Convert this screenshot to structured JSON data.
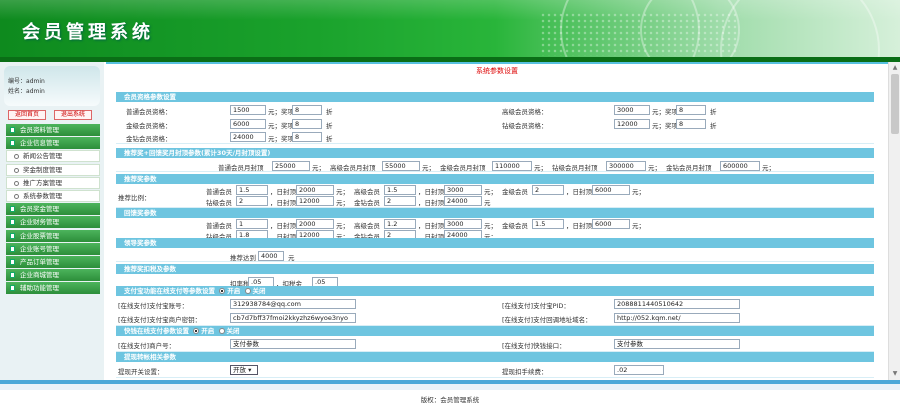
{
  "app": {
    "title": "会员管理系统",
    "footer": "版权：会员管理系统"
  },
  "user": {
    "id_label": "编号：",
    "id_value": "admin",
    "name_label": "姓名：",
    "name_value": "admin"
  },
  "sidebar": {
    "buttons": [
      "返回首页",
      "退出系统"
    ],
    "items": [
      {
        "type": "group",
        "label": "会员资料管理"
      },
      {
        "type": "group",
        "label": "企业信息管理"
      },
      {
        "type": "sub",
        "label": "新闻公告管理"
      },
      {
        "type": "sub",
        "label": "奖金制度管理"
      },
      {
        "type": "sub",
        "label": "推广方案管理"
      },
      {
        "type": "sub",
        "label": "系统参数管理"
      },
      {
        "type": "group",
        "label": "会员奖金管理"
      },
      {
        "type": "group",
        "label": "企业财务管理"
      },
      {
        "type": "group",
        "label": "企业股票管理"
      },
      {
        "type": "group",
        "label": "企业账号管理"
      },
      {
        "type": "group",
        "label": "产品订单管理"
      },
      {
        "type": "group",
        "label": "企业商城管理"
      },
      {
        "type": "group",
        "label": "辅助功能管理"
      }
    ]
  },
  "page": {
    "title": "系统参数设置",
    "s1": "会员资格参数设置",
    "s1_rows": {
      "a_label": "普通会员资格：",
      "a_val": "1500",
      "a_unit": "元；奖项",
      "a_val2": "8",
      "a_unit2": "折",
      "b_label": "高级会员资格：",
      "b_val": "3000",
      "b_unit": "元；奖项",
      "b_val2": "8",
      "b_unit2": "折",
      "c_label": "金级会员资格：",
      "c_val": "6000",
      "c_unit": "元；奖项",
      "c_val2": "8",
      "c_unit2": "折",
      "d_label": "钻级会员资格：",
      "d_val": "12000",
      "d_unit": "元；奖项",
      "d_val2": "8",
      "d_unit2": "折",
      "e_label": "金钻会员资格：",
      "e_val": "24000",
      "e_unit": "元；奖项",
      "e_val2": "8",
      "e_unit2": "折"
    },
    "s2": "推荐奖+回馈奖月封顶参数(累计30天/月封顶设置)",
    "s2_row": {
      "l1": "普通会员月封顶",
      "v1": "25000",
      "u1": "元；",
      "l2": "高级会员月封顶",
      "v2": "55000",
      "u2": "元；",
      "l3": "金级会员月封顶",
      "v3": "110000",
      "u3": "元；",
      "l4": "钻级会员月封顶",
      "v4": "300000",
      "u4": "元；",
      "l5": "金钻会员月封顶",
      "v5": "600000",
      "u5": "元；"
    },
    "s3": "推荐奖参数",
    "s3_row": {
      "side_label": "推荐比例：",
      "r1": [
        {
          "l": "普通会员",
          "v": "1.5",
          "m": "，日封顶",
          "c": "2000",
          "u": "元；"
        },
        {
          "l": "高级会员",
          "v": "1.5",
          "m": "，日封顶",
          "c": "3000",
          "u": "元；"
        },
        {
          "l": "金级会员",
          "v": "2",
          "m": "，日封顶",
          "c": "6000",
          "u": "元；"
        }
      ],
      "r2": [
        {
          "l": "钻级会员",
          "v": "2",
          "m": "，日封顶",
          "c": "12000",
          "u": "元；"
        },
        {
          "l": "金钻会员",
          "v": "2",
          "m": "，日封顶",
          "c": "24000",
          "u": "元"
        }
      ]
    },
    "s4": "回馈奖参数",
    "s4_row": {
      "r1": [
        {
          "l": "普通会员",
          "v": "1",
          "m": "，日封顶",
          "c": "2000",
          "u": "元；"
        },
        {
          "l": "高级会员",
          "v": "1.2",
          "m": "，日封顶",
          "c": "3000",
          "u": "元；"
        },
        {
          "l": "金级会员",
          "v": "1.5",
          "m": "，日封顶",
          "c": "6000",
          "u": "元；"
        }
      ],
      "r2": [
        {
          "l": "钻级会员",
          "v": "1.8",
          "m": "，日封顶",
          "c": "12000",
          "u": "元；"
        },
        {
          "l": "金钻会员",
          "v": "2",
          "m": "，日封顶",
          "c": "24000",
          "u": "元；"
        }
      ]
    },
    "s5": "领导奖参数",
    "s5_row": {
      "l": "推荐达到",
      "v": "4000",
      "u": "元"
    },
    "s6": "推荐奖扣税及参数",
    "s6_row": {
      "l1": "扣率税",
      "v1": ".05",
      "u1": "，扣税金",
      "v2": ".05"
    },
    "s7": "支付宝功能在线支付等参数设置",
    "s7_opts": {
      "on": "开启",
      "off": "关闭"
    },
    "s7_rows": {
      "l1": "[在线支付]支付宝账号：",
      "v1": "312938784@qq.com",
      "l2": "[在线支付]支付宝PID：",
      "v2": "2088811440510642",
      "l3": "[在线支付]支付宝商户密钥：",
      "v3": "cb7d7bff37fmoi2kkyzhz6wyoe3nyo",
      "l4": "[在线支付]支付回调地址域名：",
      "v4": "http://052.kqm.net/"
    },
    "s8": "快钱在线支付参数设置",
    "s8_opts": {
      "on": "开启",
      "off": "关闭"
    },
    "s8_rows": {
      "l1": "[在线支付]商户号：",
      "v1": "支付参数",
      "l2": "[在线支付]快钱接口：",
      "v2": "支付参数"
    },
    "s9": "提现转帐相关参数",
    "s9_rows": {
      "l1": "提现开关设置：",
      "v1": "开放",
      "l2": "提现扣手续费：",
      "v2": ".02"
    }
  }
}
